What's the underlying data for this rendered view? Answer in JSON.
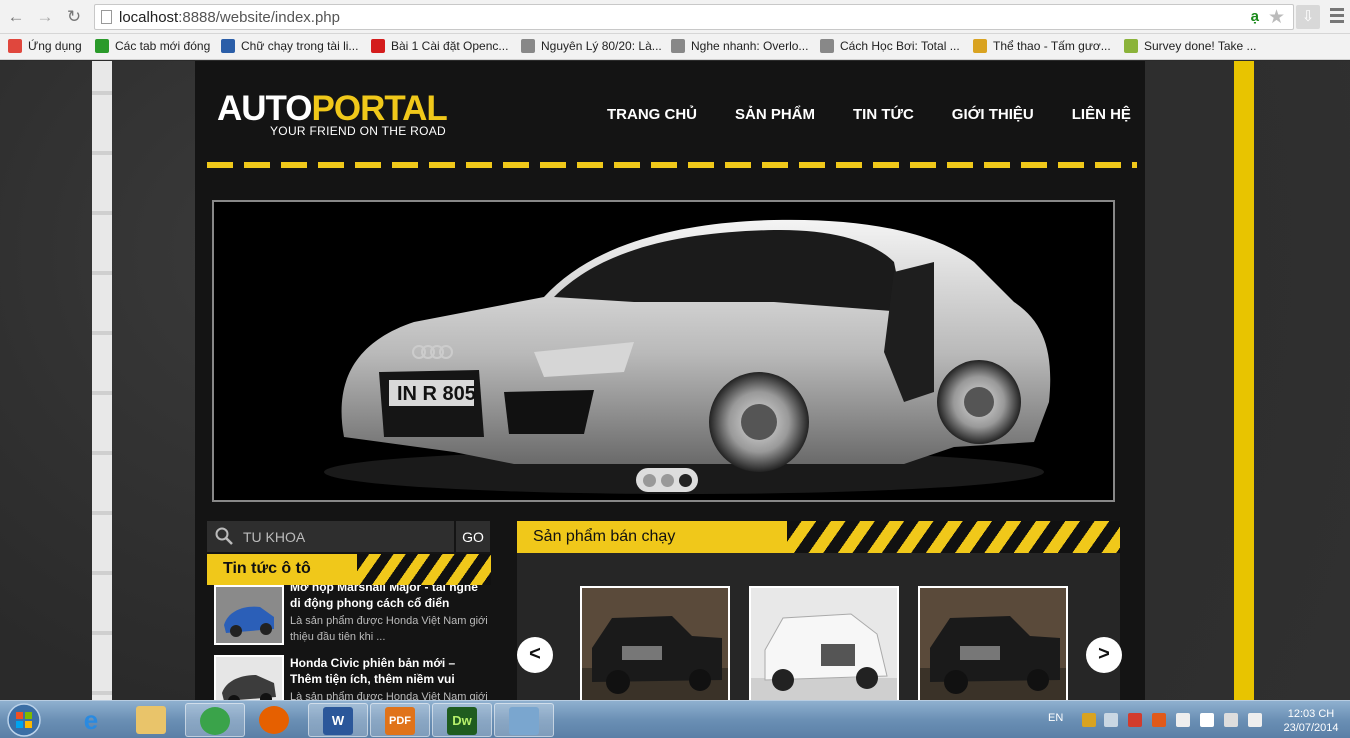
{
  "browser": {
    "url_host": "localhost",
    "url_rest": ":8888/website/index.php",
    "translate_label": "ạ",
    "bookmarks": [
      "Ứng dụng",
      "Các tab mới đóng",
      "Chữ chạy trong tài li...",
      "Bài 1 Cài đặt Openc...",
      "Nguyên Lý 80/20: Là...",
      "Nghe nhanh: Overlo...",
      "Cách Học Bơi: Total ...",
      "Thể thao - Tấm gươ...",
      "Survey done! Take ..."
    ],
    "bookmark_icon_colors": [
      "#e0473d",
      "#2a9a2a",
      "#2b5ea8",
      "#d41c1c",
      "#888888",
      "#888888",
      "#888888",
      "#d9a321",
      "#8bb33a"
    ]
  },
  "site": {
    "logo_part1": "AUTO",
    "logo_part2": "PORTAL",
    "tagline": "YOUR FRIEND ON THE ROAD",
    "nav": [
      "TRANG CHỦ",
      "SẢN PHẨM",
      "TIN TỨC",
      "GIỚI THIỆU",
      "LIÊN HỆ"
    ],
    "accent_color": "#f0c81a",
    "slider": {
      "dot_count": 3,
      "active_dot": 3
    },
    "search": {
      "placeholder": "TU KHOA",
      "button": "GO"
    },
    "news": {
      "title": "Tin tức ô tô",
      "items": [
        {
          "title": "Mở hộp Marshall Major - tai nghe di động phong cách cổ điển",
          "desc": "Là sản phẩm được Honda Việt Nam giới thiệu đầu tiên khi ..."
        },
        {
          "title": "Honda Civic phiên bản mới – Thêm tiện ích, thêm niềm vui",
          "desc": "Là sản phẩm được Honda Việt Nam giới ..."
        }
      ]
    },
    "best_sellers": {
      "title": "Sản phẩm bán chạy",
      "prev": "<",
      "next": ">"
    }
  },
  "taskbar": {
    "apps": [
      "Internet Explorer",
      "File Explorer",
      "Cốc Cốc",
      "Firefox",
      "Word",
      "PDF",
      "Dw",
      "Remote"
    ],
    "app_labels": {
      "word": "W",
      "pdf": "PDF",
      "dw": "Dw"
    },
    "lang": "EN",
    "time": "12:03 CH",
    "date": "23/07/2014"
  }
}
